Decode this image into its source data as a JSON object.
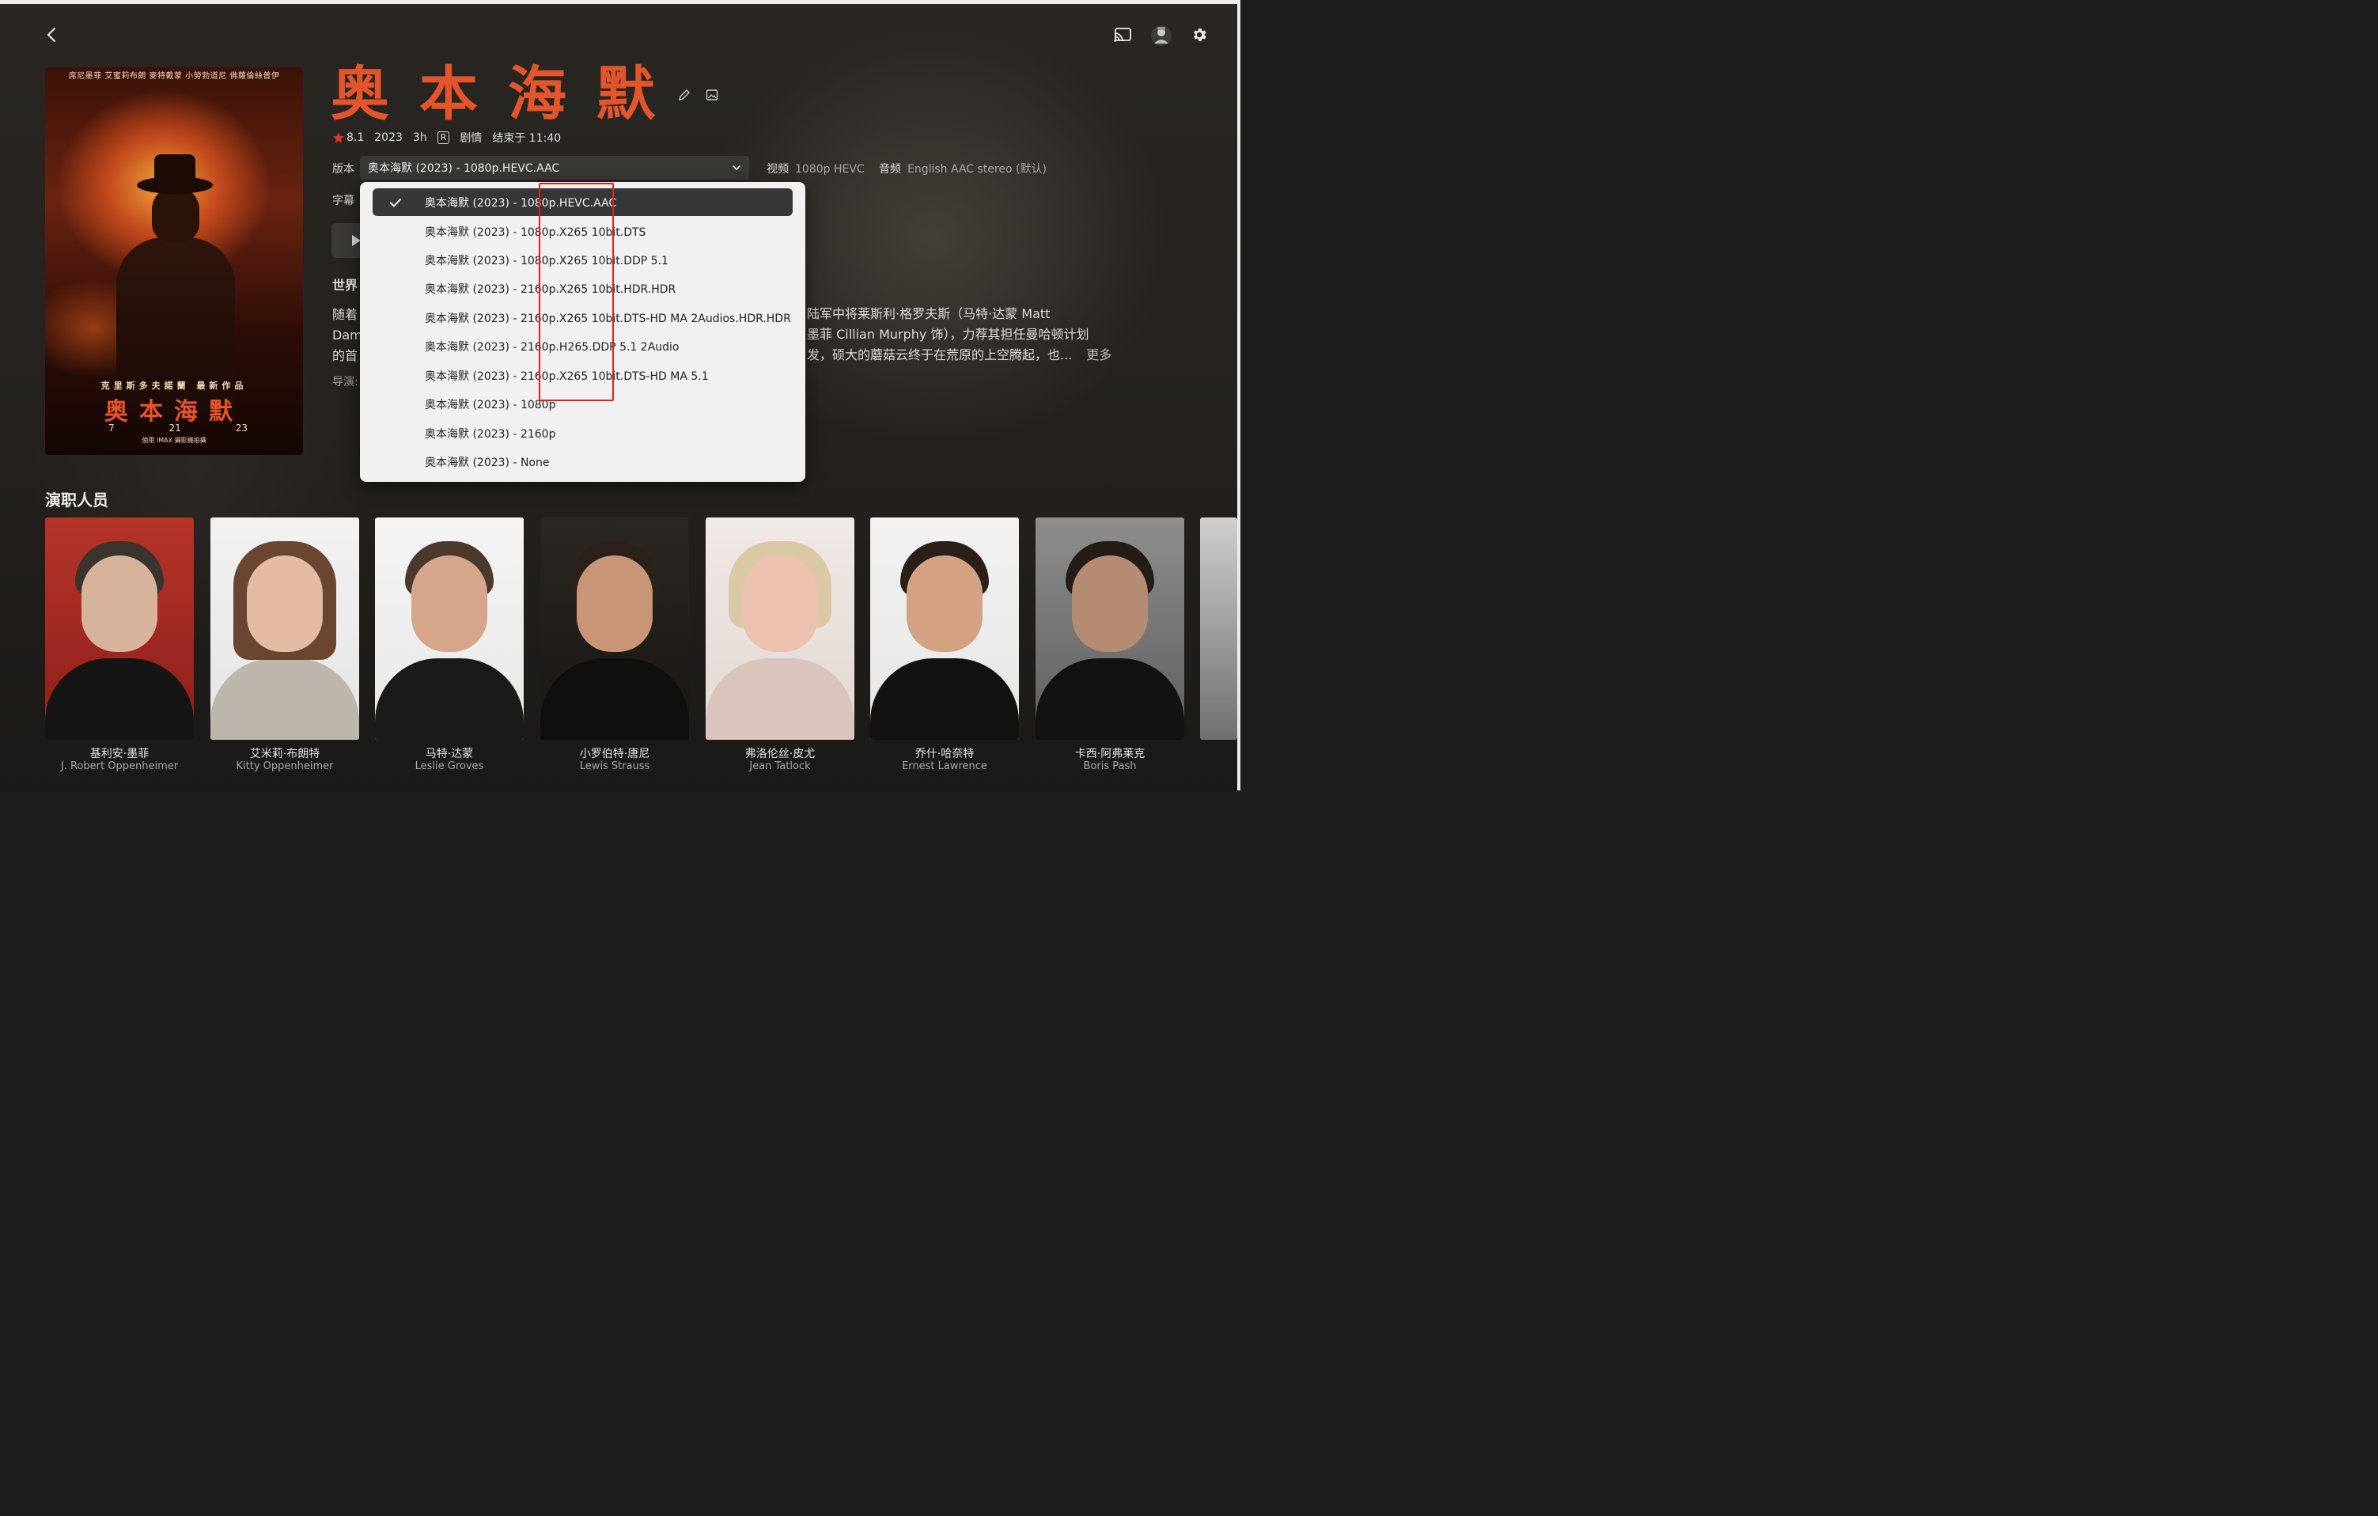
{
  "movie": {
    "title": "奥本海默",
    "rating": "8.1",
    "year": "2023",
    "runtime": "3h",
    "certification": "R",
    "genre": "剧情",
    "ends_at": "结束于 11:40"
  },
  "labels": {
    "version": "版本",
    "subtitle": "字幕",
    "video": "视频",
    "audio": "音频",
    "cast": "演职人员",
    "more": "更多"
  },
  "version_select": {
    "selected": "奥本海默 (2023) - 1080p.HEVC.AAC",
    "options": [
      "奥本海默 (2023) - 1080p.HEVC.AAC",
      "奥本海默 (2023) - 1080p.X265 10bit.DTS",
      "奥本海默 (2023) - 1080p.X265 10bit.DDP 5.1",
      "奥本海默 (2023) - 2160p.X265 10bit.HDR.HDR",
      "奥本海默 (2023) - 2160p.X265 10bit.DTS-HD MA 2Audios.HDR.HDR",
      "奥本海默 (2023) - 2160p.H265.DDP 5.1 2Audio",
      "奥本海默 (2023) - 2160p.X265 10bit.DTS-HD MA 5.1",
      "奥本海默 (2023) - 1080p",
      "奥本海默 (2023) - 2160p",
      "奥本海默 (2023) - None"
    ]
  },
  "stream": {
    "video_value": "1080p HEVC",
    "audio_value": "English AAC stereo (默认)"
  },
  "tagline_fragment": "世界",
  "overview": {
    "line1_left": "随着",
    "line2_left": "Dam",
    "line3_left": "的首",
    "line1_right": "陆军中将莱斯利·格罗夫斯（马特·达蒙 Matt",
    "line2_right": "墨菲 Cillian Murphy 饰），力荐其担任曼哈顿计划",
    "line3_right": "发，硕大的蘑菇云终于在荒原的上空腾起，也..."
  },
  "director_fragment": "导演:",
  "poster": {
    "credits": "席尼墨菲  艾蜜莉布朗  麥特戴蒙  小勞勃道尼  佛蘿倫絲普伊",
    "director": "克里斯多夫諾蘭 最新作品",
    "title": "奥本海默",
    "date": [
      "7",
      "21",
      "23"
    ],
    "imax": "使用 IMAX 攝影機拍攝"
  },
  "cast": [
    {
      "name": "基利安·墨菲",
      "role": "J. Robert Oppenheimer"
    },
    {
      "name": "艾米莉·布朗特",
      "role": "Kitty Oppenheimer"
    },
    {
      "name": "马特·达蒙",
      "role": "Leslie Groves"
    },
    {
      "name": "小罗伯特·唐尼",
      "role": "Lewis Strauss"
    },
    {
      "name": "弗洛伦丝·皮尤",
      "role": "Jean Tatlock"
    },
    {
      "name": "乔什·哈奈特",
      "role": "Ernest Lawrence"
    },
    {
      "name": "卡西·阿弗莱克",
      "role": "Boris Pash"
    }
  ],
  "colors": {
    "title_accent": "#e4552b",
    "star": "#e0312f",
    "highlight_box": "#e02020"
  },
  "icons": [
    "back-arrow-icon",
    "cast-icon",
    "avatar",
    "gear-icon",
    "pencil-icon",
    "image-icon",
    "chevron-down-icon",
    "checkmark-icon",
    "star-icon",
    "play-icon"
  ]
}
